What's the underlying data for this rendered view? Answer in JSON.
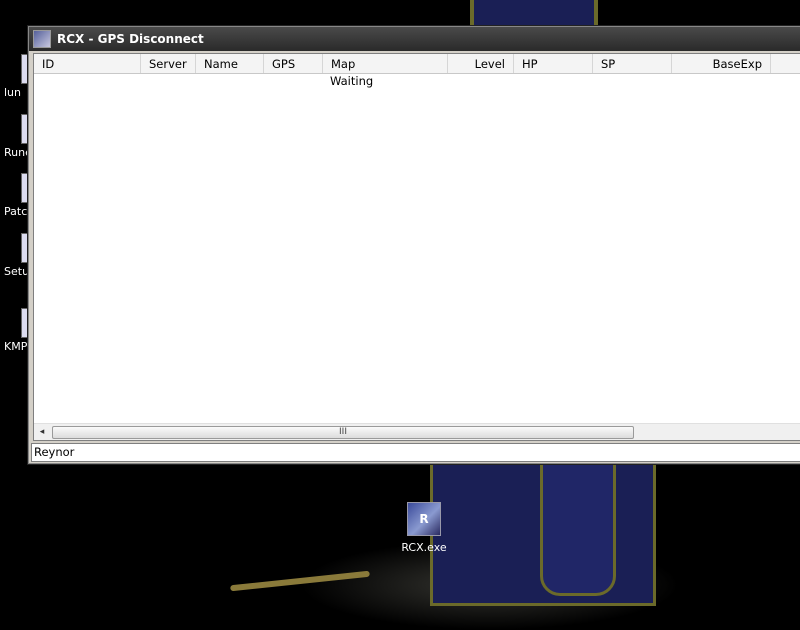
{
  "desktop": {
    "icons": [
      {
        "label": "lun"
      },
      {
        "label": "Rune-"
      },
      {
        "label": "Patc"
      },
      {
        "label": "Setu"
      },
      {
        "label": "KMP"
      }
    ],
    "exe_icon": {
      "label": "RCX.exe",
      "glyph": "R"
    }
  },
  "window": {
    "title": "RCX - GPS Disconnect",
    "columns": [
      "ID",
      "Server",
      "Name",
      "GPS",
      "Map",
      "Level",
      "HP",
      "SP",
      "BaseExp"
    ],
    "rows": [
      {
        "map": "Waiting"
      }
    ],
    "scroll_left": "◂",
    "scroll_thumb_grip": "III",
    "status_text": "Reynor"
  }
}
